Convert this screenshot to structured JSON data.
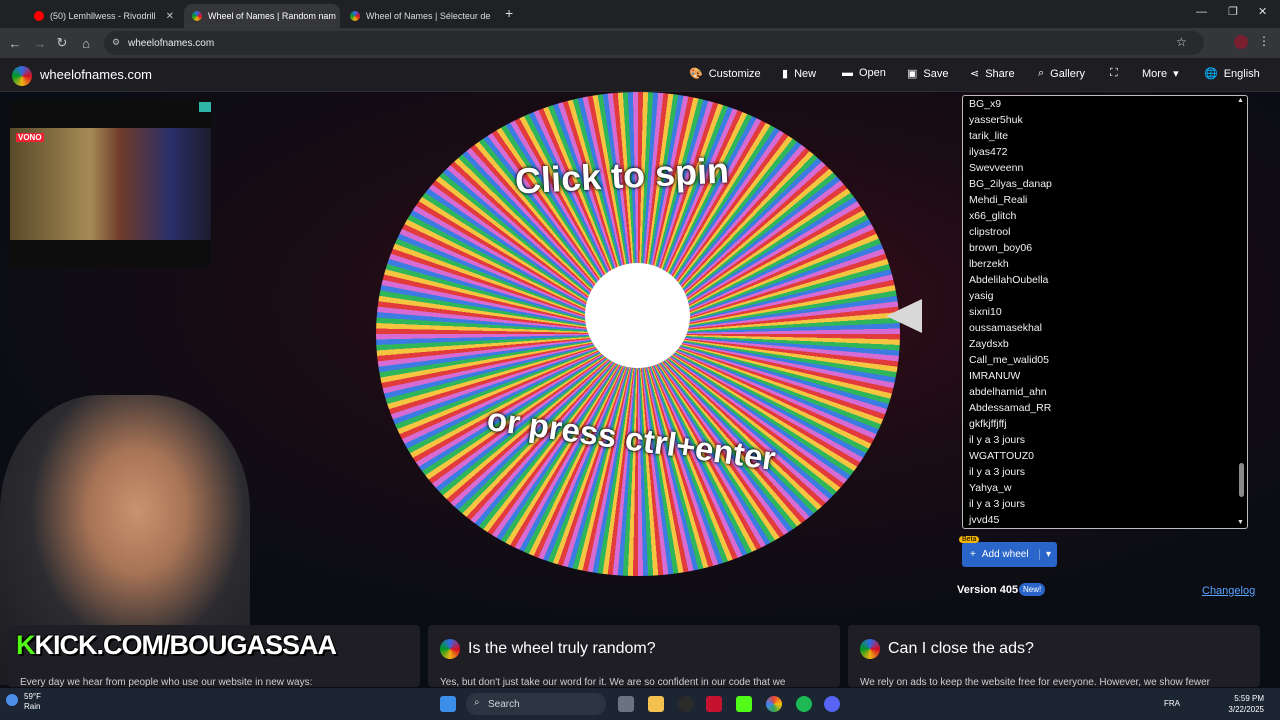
{
  "browser": {
    "tabs": [
      {
        "title": "(50) Lemhllwess - Rivodrill",
        "active": false
      },
      {
        "title": "Wheel of Names | Random nam",
        "active": true
      },
      {
        "title": "Wheel of Names | Sélecteur de",
        "active": false
      }
    ],
    "url": "wheelofnames.com"
  },
  "site": {
    "name": "wheelofnames.com",
    "menu": {
      "customize": "Customize",
      "new": "New",
      "open": "Open",
      "save": "Save",
      "share": "Share",
      "gallery": "Gallery",
      "more": "More",
      "language": "English"
    }
  },
  "wheel": {
    "top_text": "Click to spin",
    "bottom_text": "or press ctrl+enter"
  },
  "entries": [
    "BG_x9",
    "yasser5huk",
    "tarik_lite",
    "ilyas472",
    "Swevveenn",
    "BG_2ilyas_danap",
    "Mehdi_Reali",
    "x66_glitch",
    "clipstrool",
    "brown_boy06",
    "lberzekh",
    "AbdelilahOubella",
    "yasig",
    "sixni10",
    "oussamasekhal",
    "Zaydsxb",
    "Call_me_walid05",
    "IMRANUW",
    "abdelhamid_ahn",
    "Abdessamad_RR",
    "gkfkjffjffj",
    "il y a 3 jours",
    "WGATTOUZ0",
    "il y a 3 jours",
    "Yahya_w",
    "il y a 3 jours",
    "jvvd45"
  ],
  "add_wheel": {
    "label": "Add wheel",
    "badge": "Beta"
  },
  "version": {
    "label": "Version 405",
    "badge": "New!",
    "changelog": "Changelog"
  },
  "overlay": {
    "webcam_tag": "VONO",
    "kick_prefix": "K",
    "kick_text": "KICK.COM/BOUGASSAA"
  },
  "faq": [
    {
      "title": "Is the wheel truly random?",
      "body": "Yes, but don't just take our word for it. We are so confident in our code that we"
    },
    {
      "title": "Can I close the ads?",
      "body": "We rely on ads to keep the website free for everyone. However, we show fewer"
    }
  ],
  "faq_first_body": "Every day we hear from people who use our website in new ways:",
  "taskbar": {
    "weather_temp": "59°F",
    "weather_desc": "Rain",
    "search": "Search",
    "lang": "FRA",
    "time": "5:59 PM",
    "date": "3/22/2025"
  }
}
